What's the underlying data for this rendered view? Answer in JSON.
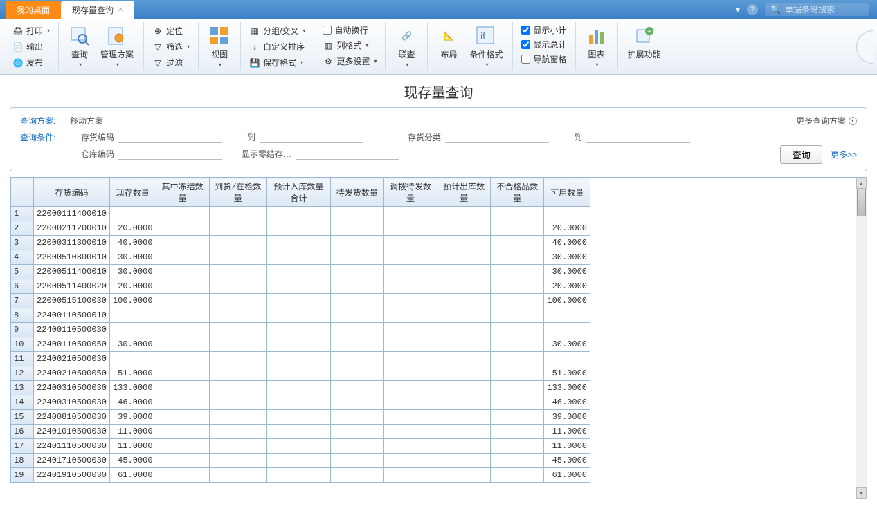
{
  "tabs": {
    "desktop": "我的桌面",
    "current": "现存量查询"
  },
  "search_placeholder": "单据条码搜索",
  "ribbon": {
    "print": "打印",
    "export": "输出",
    "publish": "发布",
    "query": "查询",
    "manage_plan": "管理方案",
    "locate": "定位",
    "filter": "筛选",
    "filter2": "过滤",
    "view": "视图",
    "group": "分组/交叉",
    "sort": "自定义排序",
    "save_fmt": "保存格式",
    "autowrap": "自动换行",
    "colfmt": "列格式",
    "more_set": "更多设置",
    "link": "联查",
    "layout": "布局",
    "cond_fmt": "条件格式",
    "show_sub": "显示小计",
    "show_total": "显示总计",
    "nav_pane": "导航窗格",
    "chart": "图表",
    "ext": "扩展功能"
  },
  "page_title": "现存量查询",
  "query": {
    "plan_label": "查询方案:",
    "plan_value": "移动方案",
    "cond_label": "查询条件:",
    "more_plans": "更多查询方案",
    "f_stock_code": "存货编码",
    "f_to": "到",
    "f_stock_cat": "存货分类",
    "f_warehouse": "仓库编码",
    "f_show_zero": "显示零结存…",
    "btn_query": "查询",
    "link_more": "更多>>"
  },
  "table": {
    "headers": [
      "",
      "存货编码",
      "现存数量",
      "其中冻结数量",
      "到货/在检数量",
      "预计入库数量合计",
      "待发货数量",
      "调拨待发数量",
      "预计出库数量",
      "不合格品数量",
      "可用数量"
    ],
    "rows": [
      {
        "n": "1",
        "code": "22000111400010",
        "qty": "",
        "avail": ""
      },
      {
        "n": "2",
        "code": "22000211200010",
        "qty": "20.0000",
        "avail": "20.0000"
      },
      {
        "n": "3",
        "code": "22000311300010",
        "qty": "40.0000",
        "avail": "40.0000"
      },
      {
        "n": "4",
        "code": "22000510800010",
        "qty": "30.0000",
        "avail": "30.0000"
      },
      {
        "n": "5",
        "code": "22000511400010",
        "qty": "30.0000",
        "avail": "30.0000"
      },
      {
        "n": "6",
        "code": "22000511400020",
        "qty": "20.0000",
        "avail": "20.0000"
      },
      {
        "n": "7",
        "code": "22000515100030",
        "qty": "100.0000",
        "avail": "100.0000"
      },
      {
        "n": "8",
        "code": "22400110500010",
        "qty": "",
        "avail": ""
      },
      {
        "n": "9",
        "code": "22400110500030",
        "qty": "",
        "avail": ""
      },
      {
        "n": "10",
        "code": "22400110500050",
        "qty": "30.0000",
        "avail": "30.0000"
      },
      {
        "n": "11",
        "code": "22400210500030",
        "qty": "",
        "avail": ""
      },
      {
        "n": "12",
        "code": "22400210500050",
        "qty": "51.0000",
        "avail": "51.0000"
      },
      {
        "n": "13",
        "code": "22400310500030",
        "qty": "133.0000",
        "avail": "133.0000"
      },
      {
        "n": "14",
        "code": "22400310500030",
        "qty": "46.0000",
        "avail": "46.0000"
      },
      {
        "n": "15",
        "code": "22400810500030",
        "qty": "39.0000",
        "avail": "39.0000"
      },
      {
        "n": "16",
        "code": "22401010500030",
        "qty": "11.0000",
        "avail": "11.0000"
      },
      {
        "n": "17",
        "code": "22401110500030",
        "qty": "11.0000",
        "avail": "11.0000"
      },
      {
        "n": "18",
        "code": "22401710500030",
        "qty": "45.0000",
        "avail": "45.0000"
      },
      {
        "n": "19",
        "code": "22401910500030",
        "qty": "61.0000",
        "avail": "61.0000"
      }
    ]
  }
}
